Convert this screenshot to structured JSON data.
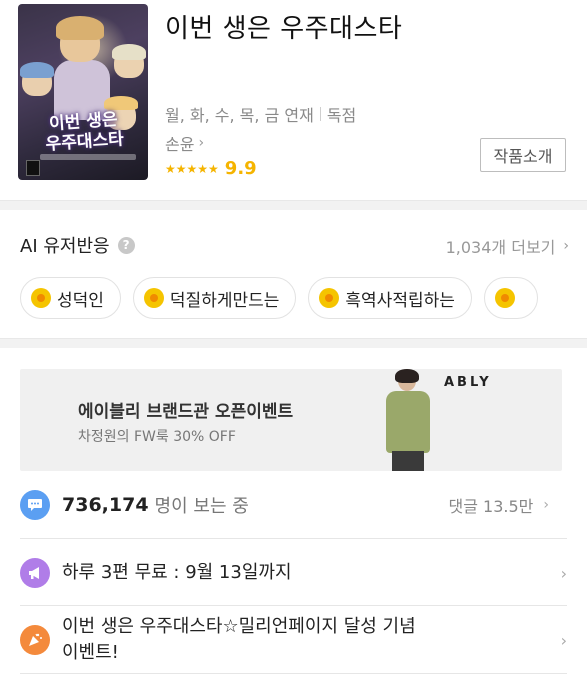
{
  "header": {
    "title": "이번 생은 우주대스타",
    "cover_title_line1": "이번 생은",
    "cover_title_line2": "우주대스타",
    "schedule": "월, 화, 수, 목, 금 연재",
    "exclusive": "독점",
    "author": "손윤",
    "stars": "★★★★★",
    "score": "9.9",
    "intro_button": "작품소개"
  },
  "ai_reactions": {
    "title": "AI 유저반응",
    "help": "?",
    "more": "1,034개 더보기",
    "chips": [
      {
        "label": "성덕인"
      },
      {
        "label": "덕질하게만드는"
      },
      {
        "label": "흑역사적립하는"
      },
      {
        "label": ""
      }
    ]
  },
  "banner": {
    "title": "에이블리 브랜드관 오픈이벤트",
    "subtitle": "차정원의 FW룩 30% OFF",
    "brand": "ABLY"
  },
  "views": {
    "count": "736,174",
    "label": "명이 보는 중",
    "comments": "댓글 13.5만"
  },
  "free_episodes": {
    "text": "하루 3편 무료 : 9월 13일까지"
  },
  "event": {
    "text_line1": "이번 생은 우주대스타☆밀리언페이지 달성 기념",
    "text_line2": "이벤트!"
  },
  "colors": {
    "star": "#f5b400",
    "coin": "#f5c400",
    "views_icon": "#5b9ff2",
    "free_icon": "#b07de8",
    "event_icon": "#f48a3c"
  },
  "icons": {
    "views": "speech-bubble-icon",
    "free": "megaphone-icon",
    "event": "party-popper-icon"
  }
}
